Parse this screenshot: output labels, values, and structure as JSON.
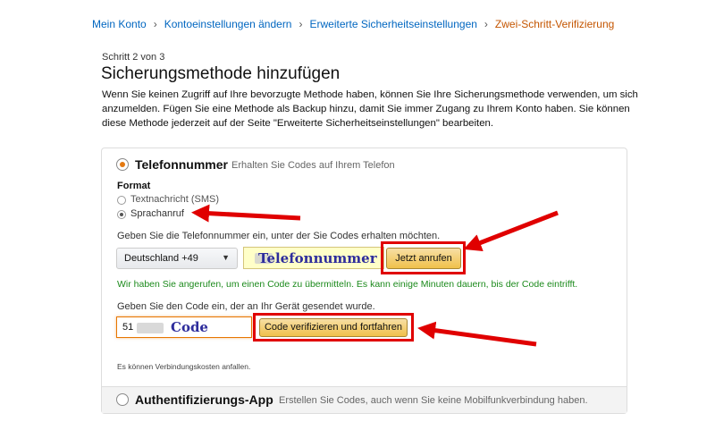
{
  "breadcrumb": {
    "items": [
      "Mein Konto",
      "Kontoeinstellungen ändern",
      "Erweiterte Sicherheitseinstellungen",
      "Zwei-Schritt-Verifizierung"
    ],
    "separator": "›"
  },
  "page": {
    "step": "Schritt 2 von 3",
    "title": "Sicherungsmethode hinzufügen",
    "intro": "Wenn Sie keinen Zugriff auf Ihre bevorzugte Methode haben, können Sie Ihre Sicherungsmethode verwenden, um sich anzumelden. Fügen Sie eine Methode als Backup hinzu, damit Sie immer Zugang zu Ihrem Konto haben. Sie können diese Methode jederzeit auf der Seite \"Erweiterte Sicherheitseinstellungen\" bearbeiten."
  },
  "phone_option": {
    "title": "Telefonnummer",
    "subtitle": "Erhalten Sie Codes auf Ihrem Telefon",
    "selected": true,
    "format_label": "Format",
    "formats": [
      {
        "label": "Textnachricht (SMS)",
        "selected": false
      },
      {
        "label": "Sprachanruf",
        "selected": true
      }
    ],
    "phone_prompt": "Geben Sie die Telefonnummer ein, unter der Sie Codes erhalten möchten.",
    "country_select": "Deutschland +49",
    "phone_overlay": "Telefonnummer",
    "call_button": "Jetzt anrufen",
    "success_message": "Wir haben Sie angerufen, um einen Code zu übermitteln. Es kann einige Minuten dauern, bis der Code eintrifft.",
    "code_prompt": "Geben Sie den Code ein, der an Ihr Gerät gesendet wurde.",
    "code_value": "51",
    "code_overlay": "Code",
    "verify_button": "Code verifizieren und fortfahren",
    "cost_note": "Es können Verbindungskosten anfallen."
  },
  "auth_app_option": {
    "title": "Authentifizierungs-App",
    "subtitle": "Erstellen Sie Codes, auch wenn Sie keine Mobilfunkverbindung haben.",
    "selected": false
  },
  "colors": {
    "link": "#0066c0",
    "current_crumb": "#c45500",
    "accent": "#e47911",
    "success": "#1c8a1c",
    "annotation_red": "#e00000",
    "overlay_text": "#2e2d9c"
  }
}
